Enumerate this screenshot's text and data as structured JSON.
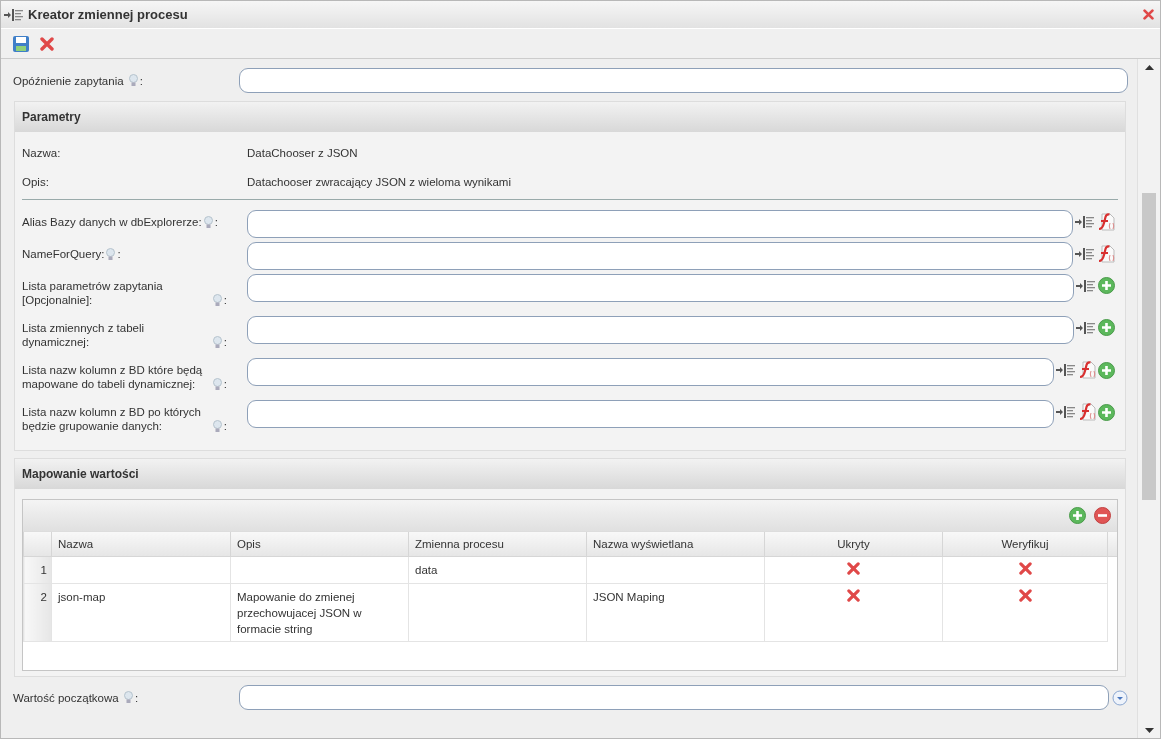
{
  "window": {
    "title": "Kreator zmiennej procesu"
  },
  "query_delay": {
    "label": "Opóźnienie zapytania",
    "suffix": ":"
  },
  "parameters": {
    "title": "Parametry",
    "info": [
      {
        "label": "Nazwa:",
        "value": "DataChooser z JSON"
      },
      {
        "label": "Opis:",
        "value": "Datachooser zwracający JSON z wieloma wynikami"
      }
    ],
    "fields": [
      {
        "label": "Alias Bazy danych w dbExplorerze:",
        "suffix": ":",
        "insert_button": true,
        "function_button": true,
        "add_button": false
      },
      {
        "label": "NameForQuery:",
        "suffix": ":",
        "insert_button": true,
        "function_button": true,
        "add_button": false
      },
      {
        "label": "Lista parametrów zapytania [Opcjonalnie]:",
        "suffix": ":",
        "insert_button": true,
        "function_button": false,
        "add_button": true
      },
      {
        "label": "Lista zmiennych z tabeli dynamicznej:",
        "suffix": ":",
        "insert_button": true,
        "function_button": false,
        "add_button": true
      },
      {
        "label": "Lista nazw kolumn z BD które będą mapowane do tabeli dynamicznej:",
        "suffix": ":",
        "insert_button": true,
        "function_button": true,
        "add_button": true
      },
      {
        "label": "Lista nazw kolumn z BD po których będzie grupowanie danych:",
        "suffix": ":",
        "insert_button": true,
        "function_button": true,
        "add_button": true
      }
    ]
  },
  "mapping": {
    "title": "Mapowanie wartości",
    "columns": [
      "Nazwa",
      "Opis",
      "Zmienna procesu",
      "Nazwa wyświetlana",
      "Ukryty",
      "Weryfikuj"
    ],
    "rows": [
      {
        "number": "1",
        "process_variable": "data",
        "hidden": false,
        "verify": false
      },
      {
        "number": "2",
        "name": "json-map",
        "description": "Mapowanie do zmienej przechowujacej JSON w formacie string",
        "display_name": "JSON Maping",
        "hidden": false,
        "verify": false
      }
    ]
  },
  "initial_value": {
    "label": "Wartość początkowa",
    "suffix": ":"
  }
}
